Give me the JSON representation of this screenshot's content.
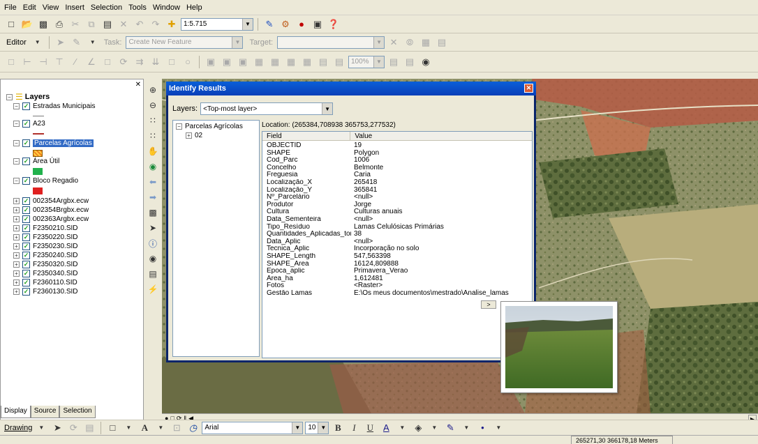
{
  "menu": [
    "File",
    "Edit",
    "View",
    "Insert",
    "Selection",
    "Tools",
    "Window",
    "Help"
  ],
  "toolbar": {
    "scale": "1:5.715",
    "editor_label": "Editor",
    "task_label": "Task:",
    "task_value": "Create New Feature",
    "target_label": "Target:",
    "zoom_value": "100%"
  },
  "toc": {
    "root": "Layers",
    "items": [
      "Estradas Municipais",
      "A23",
      "Parcelas Agrícolas",
      "Área Útil",
      "Bloco Regadio",
      "002354Argbx.ecw",
      "002354Brgbx.ecw",
      "002363Argbx.ecw",
      "F2350210.SID",
      "F2350220.SID",
      "F2350230.SID",
      "F2350240.SID",
      "F2350320.SID",
      "F2350340.SID",
      "F2360110.SID",
      "F2360130.SID"
    ],
    "tabs": [
      "Display",
      "Source",
      "Selection"
    ]
  },
  "dialog": {
    "title": "Identify Results",
    "layers_label": "Layers:",
    "layers_value": "<Top-most layer>",
    "tree_root": "Parcelas Agrícolas",
    "tree_child": "02",
    "location": "Location: (265384,708938 365753,277532)",
    "col_field": "Field",
    "col_value": "Value",
    "rows": [
      {
        "f": "OBJECTID",
        "v": "19"
      },
      {
        "f": "SHAPE",
        "v": "Polygon"
      },
      {
        "f": "Cod_Parc",
        "v": "1006"
      },
      {
        "f": "Concelho",
        "v": "Belmonte"
      },
      {
        "f": "Freguesia",
        "v": "Caria"
      },
      {
        "f": "Localização_X",
        "v": "265418"
      },
      {
        "f": "Localização_Y",
        "v": "365841"
      },
      {
        "f": "Nº_Parcelário",
        "v": "<null>"
      },
      {
        "f": "Produtor",
        "v": "Jorge"
      },
      {
        "f": "Cultura",
        "v": "Culturas anuais"
      },
      {
        "f": "Data_Sementeira",
        "v": "<null>"
      },
      {
        "f": "Tipo_Resíduo",
        "v": "Lamas Celulósicas Primárias"
      },
      {
        "f": "Quantidades_Aplicadas_ton_",
        "v": "38"
      },
      {
        "f": "Data_Aplic",
        "v": "<null>"
      },
      {
        "f": "Tecnica_Aplic",
        "v": "Incorporação no solo"
      },
      {
        "f": "SHAPE_Length",
        "v": "547,563398"
      },
      {
        "f": "SHAPE_Area",
        "v": "16124,809888"
      },
      {
        "f": "Epoca_aplic",
        "v": "Primavera_Verao"
      },
      {
        "f": "Area_ha",
        "v": "1,612481"
      },
      {
        "f": "Fotos",
        "v": "<Raster>"
      },
      {
        "f": "Gestão Lamas",
        "v": "E:\\Os meus documentos\\mestrado\\Analise_lamas"
      }
    ]
  },
  "drawing": {
    "label": "Drawing",
    "font": "Arial",
    "size": "10"
  },
  "status": {
    "coords": "265271,30  366178,18 Meters"
  },
  "colors": {
    "title_bar": "#0a3fb8",
    "selection": "#316ac5",
    "area_util": "#21b14c",
    "bloco_regadio": "#e02020"
  }
}
